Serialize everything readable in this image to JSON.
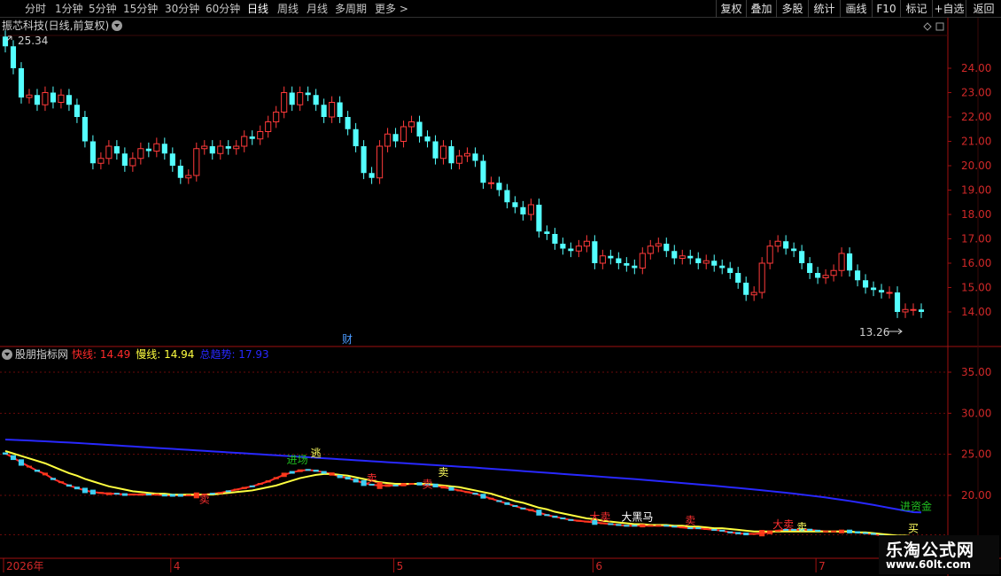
{
  "toolbar": {
    "left": [
      "分时",
      "1分钟",
      "5分钟",
      "15分钟",
      "30分钟",
      "60分钟",
      "日线",
      "周线",
      "月线",
      "多周期",
      "更多 >"
    ],
    "active": "日线",
    "right": [
      "复权",
      "叠加",
      "多股",
      "统计",
      "画线",
      "F10",
      "标记",
      "+自选",
      "返回"
    ]
  },
  "price_panel": {
    "header": "振芯科技(日线,前复权)",
    "high_label": "25.34",
    "low_label": "13.26",
    "fin_marker": "财"
  },
  "indicator_panel": {
    "name": "股朋指标网",
    "items": [
      {
        "label": "快线: 14.49",
        "color": "#ff2a2a"
      },
      {
        "label": "慢线: 14.94",
        "color": "#ffff40"
      },
      {
        "label": "总趋势: 17.93",
        "color": "#2828ff"
      }
    ],
    "signals": [
      {
        "text": "逃",
        "color": "#ffff60",
        "i": 39,
        "y": 24.7
      },
      {
        "text": "进场",
        "color": "#20c020",
        "i": 36,
        "y": 23.9
      },
      {
        "text": "卖",
        "color": "#ffff60",
        "i": 55,
        "y": 22.4
      },
      {
        "text": "卖",
        "color": "#ff3030",
        "i": 25,
        "y": 19.1
      },
      {
        "text": "卖",
        "color": "#ff3030",
        "i": 53,
        "y": 20.9
      },
      {
        "text": "卖",
        "color": "#ff3030",
        "i": 46,
        "y": 21.6
      },
      {
        "text": "大卖",
        "color": "#ff3030",
        "i": 74,
        "y": 16.9
      },
      {
        "text": "大黑马",
        "color": "#ffffff",
        "i": 78,
        "y": 16.9
      },
      {
        "text": "卖",
        "color": "#ff3030",
        "i": 86,
        "y": 16.5
      },
      {
        "text": "大卖",
        "color": "#ff3030",
        "i": 97,
        "y": 16.0
      },
      {
        "text": "卖",
        "color": "#ffff60",
        "i": 100,
        "y": 15.7
      },
      {
        "text": "进资金",
        "color": "#20c020",
        "i": 113,
        "y": 18.2
      },
      {
        "text": "买",
        "color": "#ffff60",
        "i": 114,
        "y": 15.5
      }
    ]
  },
  "x_axis": {
    "labels": [
      {
        "text": "2026年",
        "i": 0
      },
      {
        "text": "4",
        "i": 21
      },
      {
        "text": "5",
        "i": 49
      },
      {
        "text": "6",
        "i": 74
      },
      {
        "text": "7",
        "i": 102
      }
    ]
  },
  "watermark": {
    "title": "乐淘公式网",
    "url": "www.60lt.com"
  },
  "chart_data": [
    {
      "type": "candlestick",
      "title": "振芯科技(日线,前复权)",
      "ylim": [
        13.0,
        25.6
      ],
      "yticks": [
        14.0,
        15.0,
        16.0,
        17.0,
        18.0,
        19.0,
        20.0,
        21.0,
        22.0,
        23.0,
        24.0
      ],
      "series_close": [
        24.9,
        24.0,
        22.8,
        22.9,
        22.5,
        23.0,
        22.6,
        22.9,
        22.5,
        22.0,
        21.0,
        20.1,
        20.3,
        20.8,
        20.5,
        20.0,
        20.3,
        20.7,
        20.6,
        20.9,
        20.5,
        20.0,
        19.5,
        19.6,
        20.7,
        20.8,
        20.5,
        20.8,
        20.7,
        20.8,
        21.2,
        21.1,
        21.4,
        21.8,
        22.2,
        23.0,
        22.5,
        23.0,
        22.9,
        22.5,
        22.0,
        22.6,
        22.0,
        21.5,
        20.8,
        19.7,
        19.5,
        20.8,
        21.3,
        21.0,
        21.6,
        21.8,
        21.2,
        21.0,
        20.3,
        20.8,
        20.1,
        20.4,
        20.5,
        20.2,
        19.3,
        19.3,
        19.0,
        18.5,
        18.3,
        18.0,
        18.4,
        17.3,
        17.2,
        16.8,
        16.6,
        16.5,
        16.7,
        16.9,
        16.0,
        16.3,
        16.2,
        16.0,
        15.9,
        15.8,
        16.4,
        16.7,
        16.8,
        16.5,
        16.2,
        16.3,
        16.2,
        16.0,
        16.1,
        15.9,
        15.8,
        15.6,
        15.2,
        14.7,
        14.8,
        16.0,
        16.7,
        16.9,
        16.6,
        16.5,
        16.0,
        15.6,
        15.4,
        15.5,
        15.7,
        16.4,
        15.7,
        15.3,
        15.0,
        14.9,
        14.8,
        14.8,
        14.0,
        14.1,
        14.1,
        14.0
      ],
      "open_offsets_note": ""
    },
    {
      "type": "line",
      "ylim": [
        16.5,
        37.0
      ],
      "yticks": [
        20.0,
        25.0,
        30.0,
        35.0
      ],
      "series": [
        {
          "name": "快线",
          "color": "#ff2a2a",
          "values": [
            25.1,
            24.6,
            24.0,
            23.5,
            23.0,
            22.6,
            22.0,
            21.6,
            21.2,
            20.9,
            20.6,
            20.4,
            20.3,
            20.2,
            20.2,
            20.1,
            20.1,
            20.1,
            20.1,
            20.1,
            20.0,
            20.0,
            20.0,
            20.0,
            20.0,
            20.1,
            20.2,
            20.3,
            20.5,
            20.7,
            20.9,
            21.1,
            21.4,
            21.7,
            22.1,
            22.5,
            22.8,
            23.0,
            23.1,
            23.0,
            22.8,
            22.6,
            22.3,
            22.1,
            21.8,
            21.5,
            21.3,
            21.2,
            21.2,
            21.2,
            21.3,
            21.4,
            21.4,
            21.3,
            21.2,
            21.0,
            20.8,
            20.6,
            20.4,
            20.2,
            19.9,
            19.6,
            19.3,
            19.0,
            18.7,
            18.4,
            18.2,
            17.9,
            17.6,
            17.4,
            17.2,
            17.0,
            16.9,
            16.8,
            16.7,
            16.6,
            16.5,
            16.4,
            16.3,
            16.3,
            16.3,
            16.3,
            16.3,
            16.3,
            16.2,
            16.1,
            16.0,
            16.0,
            15.9,
            15.8,
            15.7,
            15.5,
            15.4,
            15.3,
            15.3,
            15.4,
            15.5,
            15.7,
            15.8,
            15.8,
            15.8,
            15.8,
            15.7,
            15.6,
            15.6,
            15.6,
            15.6,
            15.5,
            15.4,
            15.3,
            15.1,
            15.0,
            14.8,
            14.7,
            14.6,
            14.5
          ]
        },
        {
          "name": "慢线",
          "color": "#ffff40",
          "values": [
            25.4,
            25.1,
            24.8,
            24.5,
            24.2,
            23.9,
            23.5,
            23.1,
            22.7,
            22.4,
            22.0,
            21.7,
            21.4,
            21.1,
            20.9,
            20.7,
            20.5,
            20.4,
            20.3,
            20.2,
            20.2,
            20.1,
            20.1,
            20.1,
            20.1,
            20.1,
            20.1,
            20.2,
            20.3,
            20.4,
            20.5,
            20.6,
            20.8,
            21.0,
            21.2,
            21.5,
            21.8,
            22.1,
            22.3,
            22.5,
            22.6,
            22.6,
            22.5,
            22.4,
            22.2,
            22.0,
            21.8,
            21.6,
            21.5,
            21.4,
            21.4,
            21.4,
            21.4,
            21.4,
            21.3,
            21.2,
            21.1,
            21.0,
            20.8,
            20.6,
            20.4,
            20.2,
            19.9,
            19.6,
            19.3,
            19.1,
            18.8,
            18.5,
            18.3,
            18.0,
            17.8,
            17.6,
            17.4,
            17.2,
            17.1,
            16.9,
            16.8,
            16.7,
            16.6,
            16.5,
            16.5,
            16.4,
            16.4,
            16.4,
            16.3,
            16.3,
            16.2,
            16.2,
            16.1,
            16.0,
            16.0,
            15.9,
            15.8,
            15.7,
            15.6,
            15.6,
            15.6,
            15.6,
            15.6,
            15.6,
            15.6,
            15.6,
            15.6,
            15.6,
            15.6,
            15.6,
            15.6,
            15.5,
            15.5,
            15.4,
            15.3,
            15.2,
            15.1,
            15.1,
            15.0,
            14.9
          ]
        },
        {
          "name": "总趋势",
          "color": "#2828ff",
          "values": [
            26.8,
            26.76,
            26.72,
            26.68,
            26.63,
            26.58,
            26.53,
            26.48,
            26.43,
            26.38,
            26.32,
            26.26,
            26.2,
            26.14,
            26.08,
            26.02,
            25.96,
            25.9,
            25.84,
            25.78,
            25.72,
            25.66,
            25.6,
            25.54,
            25.48,
            25.42,
            25.36,
            25.3,
            25.24,
            25.18,
            25.12,
            25.06,
            25.0,
            24.94,
            24.88,
            24.82,
            24.76,
            24.7,
            24.64,
            24.58,
            24.52,
            24.46,
            24.4,
            24.34,
            24.28,
            24.22,
            24.16,
            24.1,
            24.04,
            23.98,
            23.92,
            23.86,
            23.8,
            23.74,
            23.68,
            23.62,
            23.56,
            23.5,
            23.44,
            23.38,
            23.31,
            23.24,
            23.17,
            23.1,
            23.03,
            22.96,
            22.89,
            22.82,
            22.75,
            22.68,
            22.61,
            22.54,
            22.47,
            22.4,
            22.33,
            22.26,
            22.19,
            22.12,
            22.05,
            21.98,
            21.9,
            21.82,
            21.74,
            21.66,
            21.58,
            21.5,
            21.42,
            21.34,
            21.26,
            21.17,
            21.08,
            20.99,
            20.9,
            20.81,
            20.72,
            20.62,
            20.52,
            20.42,
            20.32,
            20.22,
            20.1,
            19.98,
            19.86,
            19.74,
            19.6,
            19.46,
            19.32,
            19.16,
            19.0,
            18.84,
            18.66,
            18.48,
            18.3,
            18.12,
            17.95,
            17.93
          ]
        }
      ]
    }
  ]
}
